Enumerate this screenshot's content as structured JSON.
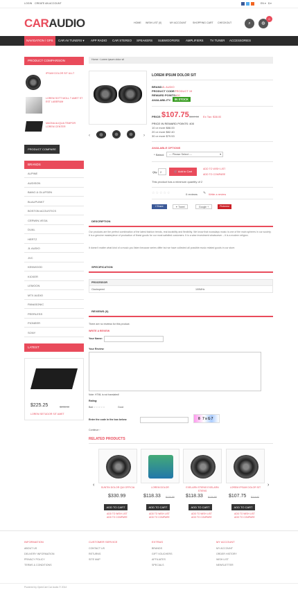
{
  "topbar": {
    "login": "LOGIN",
    "create": "CREATE AN ACCOUNT",
    "lang": "EN ▾",
    "cur": "$ ▾"
  },
  "logo": {
    "part1": "CAR",
    "part2": "AUDIO"
  },
  "header_links": [
    "HOME",
    "WISH LIST (0)",
    "MY ACCOUNT",
    "SHOPPING CART",
    "CHECKOUT"
  ],
  "cart_count": "0",
  "nav": [
    "NAVIGATION / GPS",
    "CAR AV TUNERS ▾",
    "APP RADIO",
    "CAR STEREO",
    "SPEAKERS",
    "SUBWOOFERS",
    "AMPLIFIERS",
    "TV TUNER",
    "ACCESSORIES"
  ],
  "compare": {
    "title": "PRODUCT COMPARISON",
    "items": [
      "IPSUM DOLOR SIT ULLT",
      "LOREM SOTT MOLL T AMET ST EST LABERUM",
      "MAGNA ALIQUA TEMPOR LOREM CENTER"
    ],
    "button": "PRODUCT COMPARE"
  },
  "brands": {
    "title": "BRANDS",
    "items": [
      "ALPINE",
      "AUDISON",
      "BANG & OLUFSEN",
      "BLAUPUNKT",
      "BOSTON ACOUSTICS",
      "CERWIN-VEGA",
      "DUAL",
      "HERTZ",
      "JL AUDIO",
      "JVC",
      "KENWOOD",
      "KICKER",
      "LEMOON",
      "MTX AUDIO",
      "PANASONIC",
      "PEERLESS",
      "PIONEER",
      "SONY"
    ]
  },
  "latest": {
    "title": "LATEST",
    "price": "$225.25",
    "old": "$235.98",
    "name": "LOREM SETUDOR SIT AMET"
  },
  "breadcrumb": "Home › Lorem ipsum dolor sit",
  "product": {
    "name": "LOREM IPSUM DOLOR SIT",
    "brand_label": "BRAND:",
    "brand": "JL AUDIO",
    "code_label": "PRODUCT CODE:",
    "code": "PRODUCT 19",
    "reward_label": "REWARD POINTS:",
    "reward": "100",
    "avail_label": "AVAILABILITY:",
    "avail": "IN STOCK",
    "price_label": "PRICE:",
    "price": "$107.75",
    "old_price": "$119.50",
    "save": "Ex Tax: $38.00",
    "reward_line": "PRICE IN REWARD POINTS: 400",
    "disc": [
      "10 or more $88.00",
      "20 or more $82.40",
      "30 or more $79.53"
    ],
    "options_title": "AVAILABLE OPTIONS",
    "select_label": "* Select:",
    "select_val": "--- Please Select ---",
    "qty_label": "Qty:",
    "qty": "2",
    "add_cart": "Add to Cart",
    "wish": "ADD TO WISH LIST",
    "compare": "ADD TO COMPARE",
    "minimum": "This product has a minimum quantity of 2",
    "reviews": "0 reviews",
    "write": "Write a review",
    "share": [
      "Share",
      "Tweet",
      "Google +",
      "Pinterest"
    ]
  },
  "description": {
    "title": "DESCRIPTION",
    "p1": "Our products are the perfect combination of the latest fashion trends, real durability and flexibility. We know that nowadays music is one of the main spheres in our society. It is a genuine masterpiece of production of finest goods for our most satisfied customers. It is a wise investment whatsoever – it is a modern religion.",
    "p2": "It doesn't matter what kind of a music you listen because series differ but we have collected all possible music related goods in our store."
  },
  "spec": {
    "title": "SPECIFICATION",
    "group": "PROCESSOR",
    "key": "Clockspeed",
    "val": "100MHz"
  },
  "reviews": {
    "title": "REVIEWS (0)",
    "none": "There are no reviews for this product.",
    "write": "WRITE A REVIEW",
    "name": "Your Name:",
    "review": "Your Review:",
    "note": "Note: HTML is not translated!",
    "rating": "Rating:",
    "bad": "Bad",
    "good": "Good",
    "captcha": "Enter the code in the box below:",
    "code": "8 7sG7",
    "continue": "Continue"
  },
  "related": {
    "title": "RELATED PRODUCTS",
    "items": [
      {
        "name": "SUNTIN DOLOR QUI OFFICIA",
        "price": "$330.99",
        "old": ""
      },
      {
        "name": "LOREM DOLOR",
        "price": "$118.33",
        "old": "$130.88"
      },
      {
        "name": "EXELARN STIENS EXELARN STIENS",
        "price": "$118.33",
        "old": "$130.88"
      },
      {
        "name": "LOREM IPSUM DOLOR SIT",
        "price": "$107.75",
        "old": "$119.50"
      }
    ],
    "cart": "ADD TO CART",
    "wish": "ADD TO WISH LIST",
    "compare": "ADD TO COMPARE"
  },
  "footer": {
    "cols": [
      {
        "title": "INFORMATION",
        "items": [
          "ABOUT US",
          "DELIVERY INFORMATION",
          "PRIVACY POLICY",
          "TERMS & CONDITIONS"
        ]
      },
      {
        "title": "CUSTOMER SERVICE",
        "items": [
          "CONTACT US",
          "RETURNS",
          "SITE MAP"
        ]
      },
      {
        "title": "EXTRAS",
        "items": [
          "BRANDS",
          "GIFT VOUCHERS",
          "AFFILIATES",
          "SPECIALS"
        ]
      },
      {
        "title": "MY ACCOUNT",
        "items": [
          "MY ACCOUNT",
          "ORDER HISTORY",
          "WISH LIST",
          "NEWSLETTER"
        ]
      }
    ],
    "powered": "Powered by OpenCart Car Audio © 2014"
  },
  "colors": {
    "accent": "#e94b5b",
    "dark": "#2b2b2b",
    "green": "#3a9d23"
  }
}
